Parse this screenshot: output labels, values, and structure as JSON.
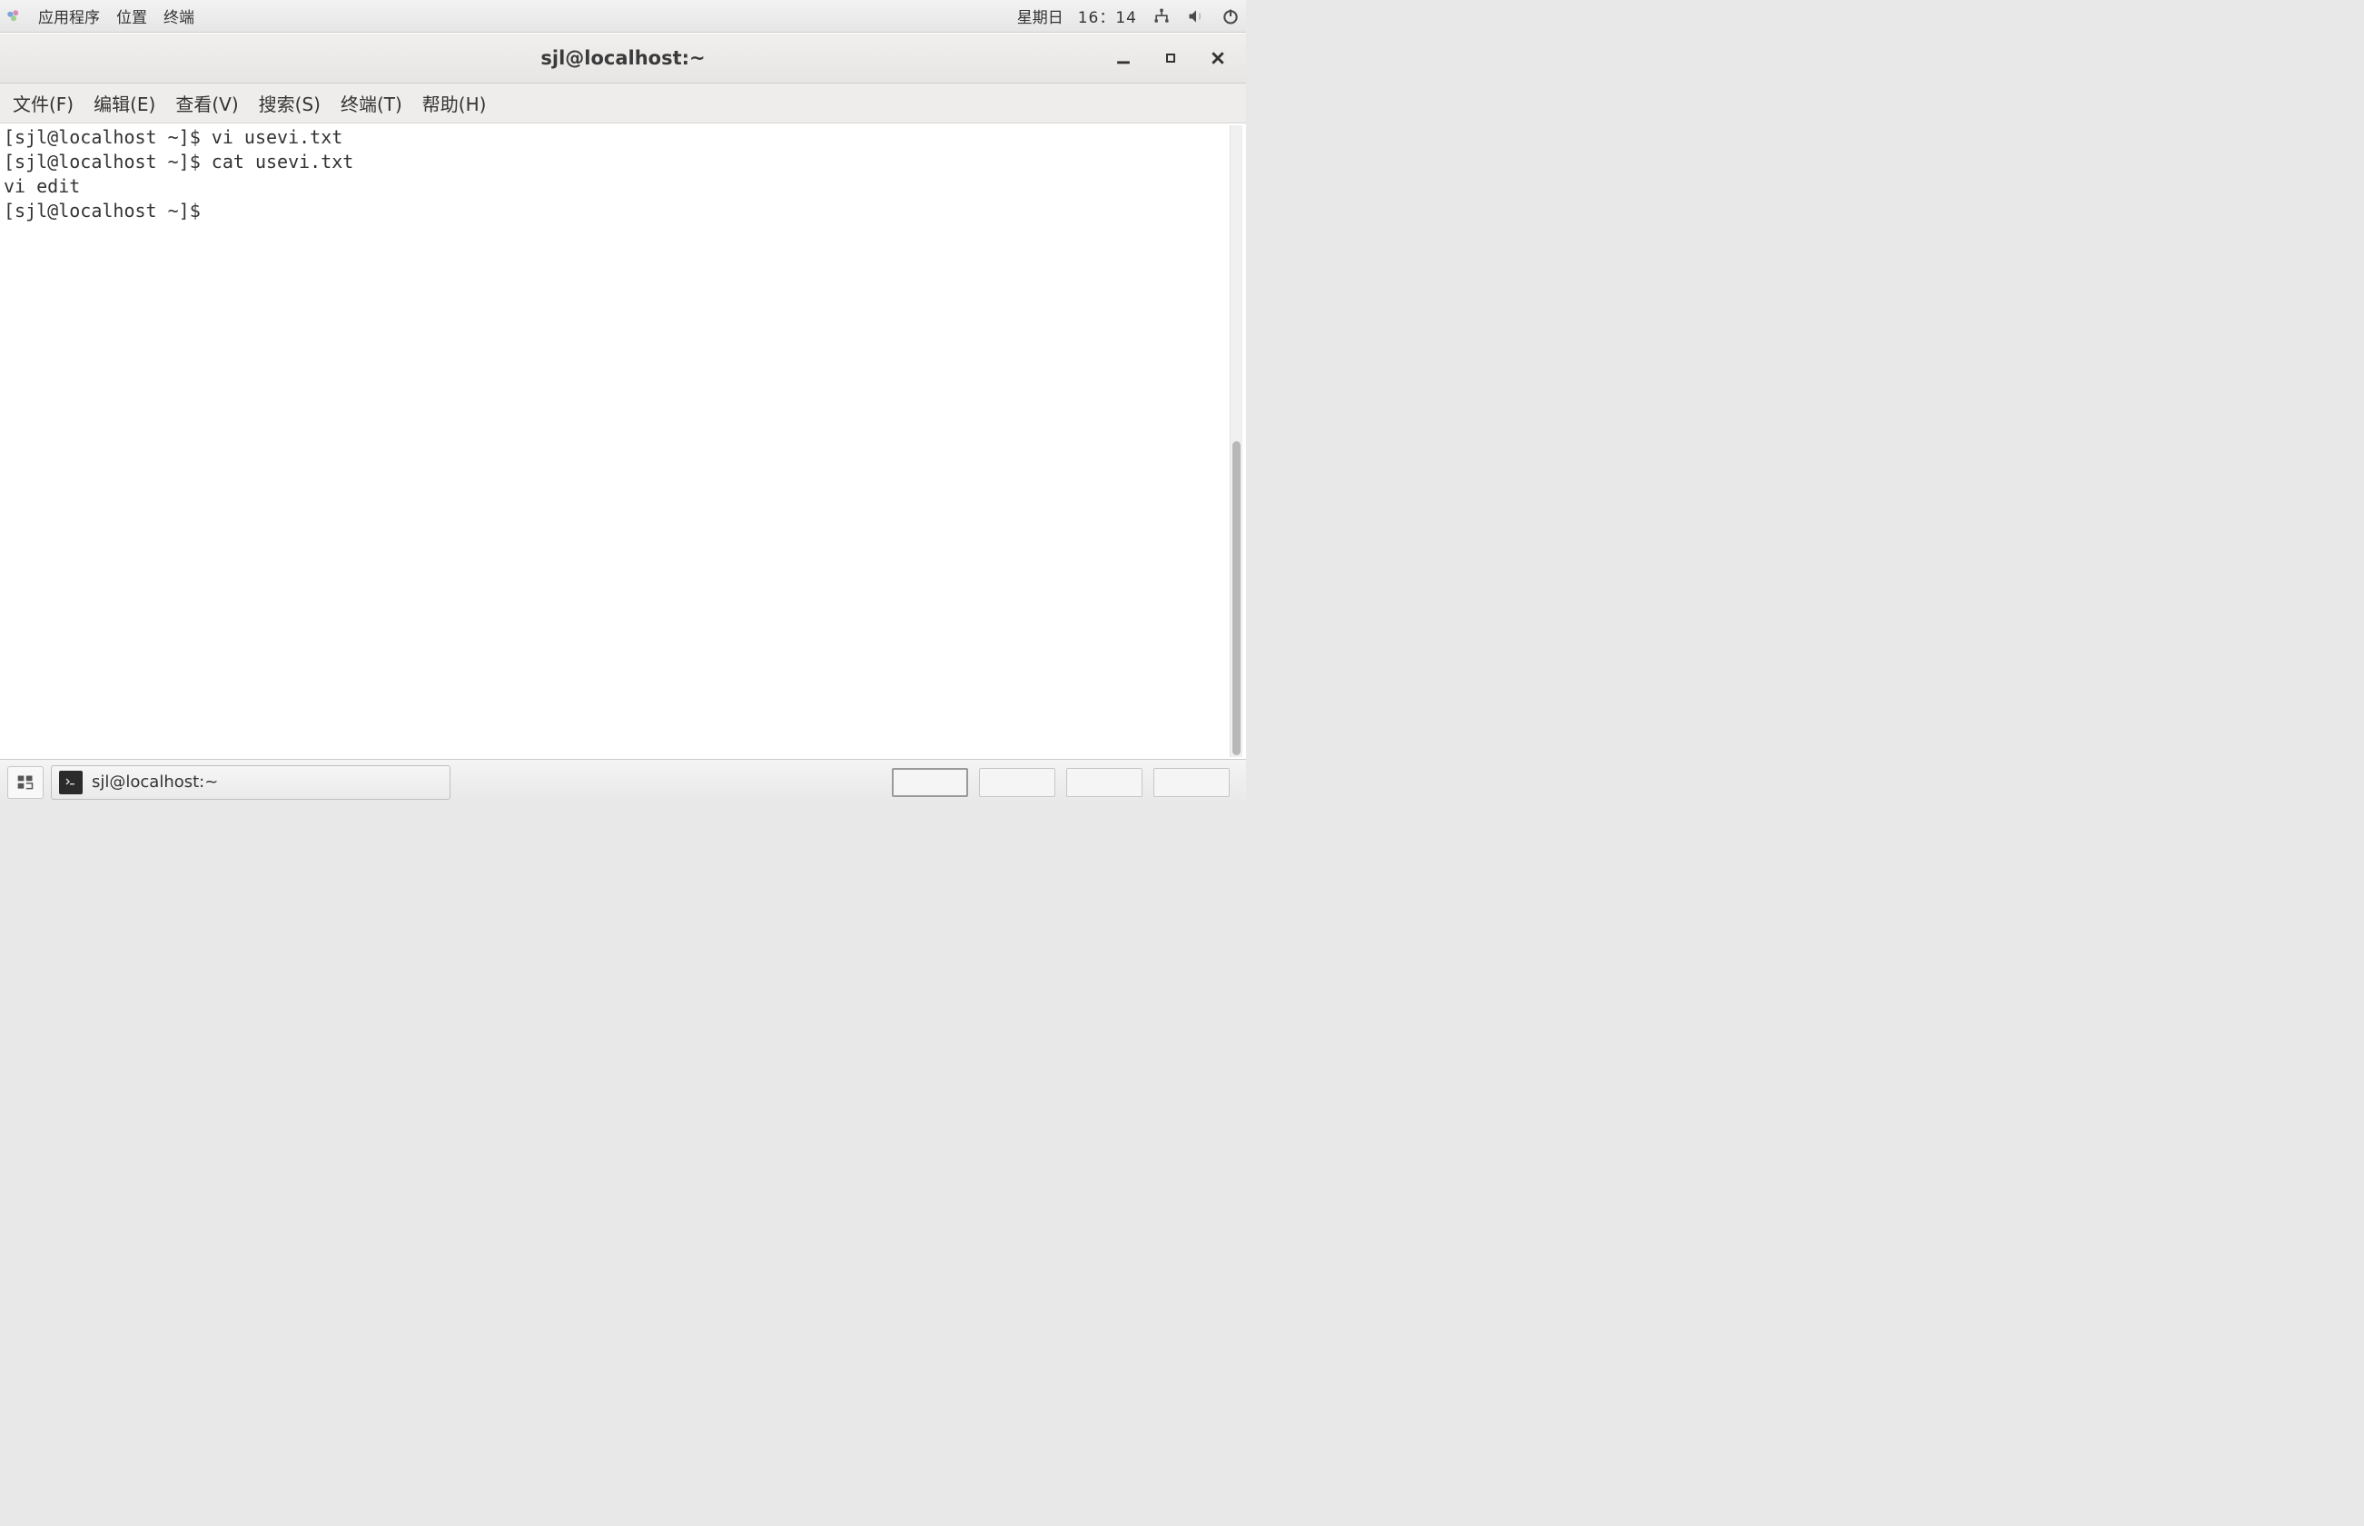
{
  "top_panel": {
    "applications": "应用程序",
    "places": "位置",
    "terminal_launcher": "终端",
    "day": "星期日",
    "time": "16：14"
  },
  "window": {
    "title": "sjl@localhost:~",
    "menubar": {
      "file": "文件(F)",
      "edit": "编辑(E)",
      "view": "查看(V)",
      "search": "搜索(S)",
      "terminal": "终端(T)",
      "help": "帮助(H)"
    },
    "terminal_lines": [
      "[sjl@localhost ~]$ vi usevi.txt",
      "[sjl@localhost ~]$ cat usevi.txt",
      "vi edit",
      "[sjl@localhost ~]$ "
    ]
  },
  "taskbar": {
    "task_label": "sjl@localhost:~"
  }
}
